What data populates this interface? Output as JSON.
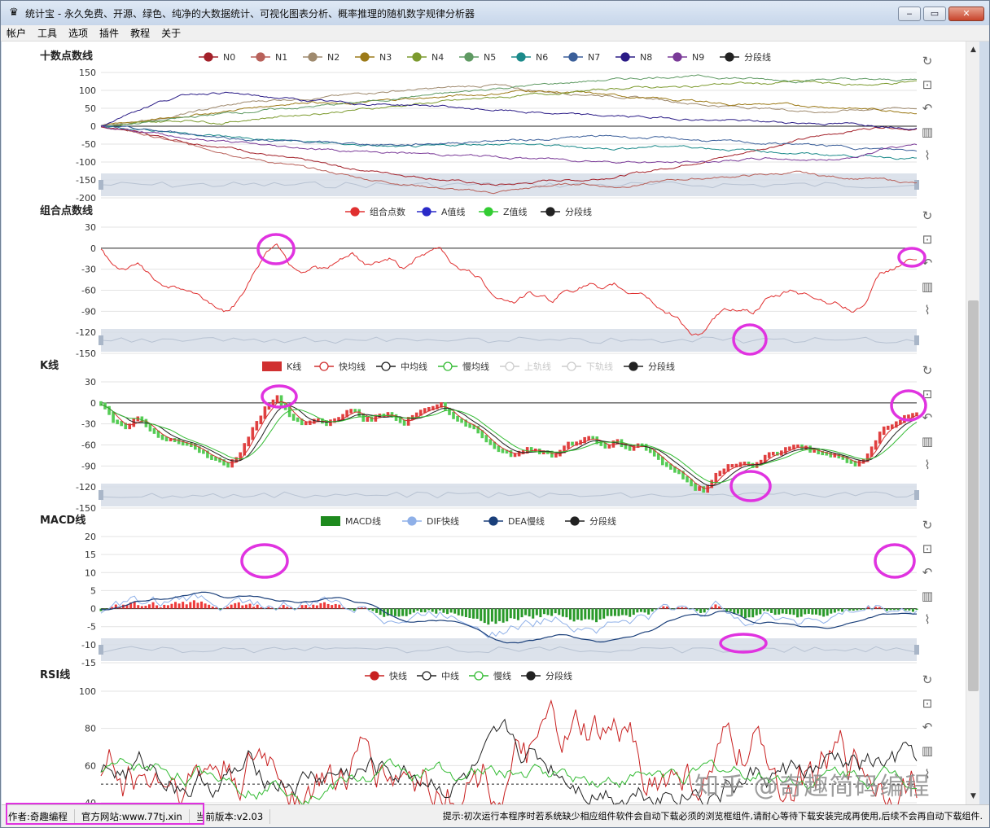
{
  "window": {
    "title": "统计宝 - 永久免费、开源、绿色、纯净的大数据统计、可视化图表分析、概率推理的随机数字规律分析器",
    "minimize": "‒",
    "restore": "▭",
    "close": "✕"
  },
  "menu": [
    "帐户",
    "工具",
    "选项",
    "插件",
    "教程",
    "关于"
  ],
  "status": {
    "author": "作者:奇趣编程",
    "site": "官方网站:www.77tj.xin",
    "version": "当前版本:v2.03",
    "tip": "提示:初次运行本程序时若系统缺少相应组件软件会自动下载必须的浏览框组件,请耐心等待下载安装完成再使用,后续不会再自动下载组件."
  },
  "watermark": "知乎 @奇趣简码编程",
  "toolbox_icons": [
    "restore-icon",
    "data-zoom-icon",
    "zoom-reset-icon",
    "bar-chart-icon",
    "line-chart-icon"
  ],
  "colors": {
    "highlight": "#e033e0",
    "zoom_bg": "#d6dde8"
  },
  "chart_data": [
    {
      "type": "line",
      "title": "十数点数线",
      "ylim": [
        -200,
        150
      ],
      "ticks": [
        150,
        100,
        50,
        0,
        -50,
        -100,
        -150,
        -200
      ],
      "series": [
        {
          "name": "N0",
          "color": "#a3212a",
          "values": [
            0,
            -12,
            -30,
            -45,
            -55,
            -70,
            -88,
            -100,
            -115,
            -125,
            -135,
            -145,
            -155,
            -165,
            -160,
            -150,
            -150,
            -140,
            -128,
            -112,
            -95,
            -80,
            -60,
            -40,
            -25,
            -10,
            0,
            -8
          ]
        },
        {
          "name": "N1",
          "color": "#b8615a",
          "values": [
            0,
            -15,
            -35,
            -55,
            -70,
            -90,
            -105,
            -120,
            -135,
            -150,
            -160,
            -170,
            -180,
            -185,
            -175,
            -165,
            -160,
            -170,
            -160,
            -150,
            -145,
            -140,
            -135,
            -130,
            -140,
            -145,
            -150,
            -160
          ]
        },
        {
          "name": "N2",
          "color": "#9f8a6e",
          "values": [
            0,
            10,
            22,
            38,
            55,
            68,
            75,
            80,
            85,
            95,
            100,
            104,
            110,
            115,
            102,
            95,
            90,
            85,
            78,
            70,
            60,
            55,
            50,
            45,
            40,
            45,
            50,
            52
          ]
        },
        {
          "name": "N3",
          "color": "#9c7a18",
          "values": [
            0,
            12,
            20,
            32,
            40,
            52,
            62,
            70,
            60,
            68,
            76,
            80,
            86,
            90,
            100,
            96,
            92,
            85,
            80,
            72,
            70,
            60,
            62,
            58,
            55,
            50,
            45,
            40
          ]
        },
        {
          "name": "N4",
          "color": "#7c9a2e",
          "values": [
            0,
            5,
            12,
            18,
            10,
            20,
            28,
            35,
            42,
            50,
            58,
            66,
            72,
            80,
            85,
            92,
            98,
            105,
            110,
            108,
            115,
            120,
            118,
            125,
            120,
            115,
            118,
            125
          ]
        },
        {
          "name": "N5",
          "color": "#5f9a63",
          "values": [
            0,
            8,
            15,
            25,
            35,
            42,
            48,
            55,
            62,
            70,
            80,
            88,
            95,
            105,
            112,
            118,
            125,
            130,
            135,
            140,
            138,
            135,
            130,
            128,
            132,
            130,
            128,
            130
          ]
        },
        {
          "name": "N6",
          "color": "#1b8a8a",
          "values": [
            0,
            -5,
            -12,
            -20,
            -28,
            -35,
            -40,
            -45,
            -50,
            -55,
            -60,
            -58,
            -52,
            -48,
            -50,
            -55,
            -60,
            -62,
            -58,
            -55,
            -60,
            -65,
            -70,
            -75,
            -80,
            -82,
            -85,
            -90
          ]
        },
        {
          "name": "N7",
          "color": "#3b5f9a",
          "values": [
            0,
            -8,
            -15,
            -22,
            -30,
            -38,
            -42,
            -45,
            -48,
            -50,
            -52,
            -48,
            -44,
            -40,
            -38,
            -35,
            -30,
            -28,
            -32,
            -35,
            -40,
            -45,
            -48,
            -50,
            -55,
            -60,
            -65,
            -68
          ]
        },
        {
          "name": "N8",
          "color": "#2a1b86",
          "values": [
            0,
            40,
            70,
            90,
            95,
            85,
            78,
            70,
            65,
            62,
            60,
            58,
            50,
            45,
            40,
            35,
            30,
            28,
            25,
            22,
            18,
            15,
            12,
            10,
            8,
            5,
            2,
            -3
          ]
        },
        {
          "name": "N9",
          "color": "#7a3a98",
          "values": [
            0,
            -10,
            -22,
            -35,
            -42,
            -50,
            -58,
            -62,
            -68,
            -72,
            -75,
            -78,
            -82,
            -85,
            -90,
            -92,
            -95,
            -98,
            -100,
            -102,
            -100,
            -95,
            -90,
            -92,
            -95,
            -85,
            -60,
            -55
          ]
        }
      ],
      "legend_extra": "分段线"
    },
    {
      "type": "line",
      "title": "组合点数线",
      "ylim": [
        -150,
        30
      ],
      "ticks": [
        30,
        0,
        -30,
        -60,
        -90,
        -120,
        -150
      ],
      "series": [
        {
          "name": "组合点数",
          "color": "#e03030",
          "values": [
            0,
            -25,
            -35,
            -20,
            -40,
            -50,
            -55,
            -60,
            -70,
            -80,
            -90,
            -75,
            -40,
            -10,
            10,
            -20,
            -30,
            -25,
            -30,
            -20,
            -10,
            -25,
            -20,
            -15,
            -30,
            -15,
            -10,
            0,
            -20,
            -30,
            -40,
            -60,
            -70,
            -75,
            -65,
            -70,
            -75,
            -60,
            -55,
            -50,
            -65,
            -55,
            -65,
            -60,
            -75,
            -90,
            -100,
            -120,
            -125,
            -100,
            -90,
            -85,
            -90,
            -75,
            -70,
            -60,
            -65,
            -70,
            -75,
            -80,
            -90,
            -75,
            -40,
            -30,
            -20,
            -15
          ]
        },
        {
          "name": "A值线",
          "color": "#2a2ac8",
          "values": []
        },
        {
          "name": "Z值线",
          "color": "#33cc33",
          "values": []
        }
      ],
      "legend_extra": "分段线"
    },
    {
      "type": "line",
      "title": "K线",
      "ylim": [
        -150,
        30
      ],
      "ticks": [
        30,
        0,
        -30,
        -60,
        -90,
        -120,
        -150
      ],
      "series": [
        {
          "name": "K线",
          "color": "#d03030",
          "values": []
        },
        {
          "name": "快均线",
          "color": "#d03030",
          "values": []
        },
        {
          "name": "中均线",
          "color": "#222222",
          "values": []
        },
        {
          "name": "慢均线",
          "color": "#33bb33",
          "values": []
        },
        {
          "name": "上轨线",
          "color": "#cccccc",
          "values": []
        },
        {
          "name": "下轨线",
          "color": "#cccccc",
          "values": []
        }
      ],
      "legend_extra": "分段线"
    },
    {
      "type": "bar",
      "title": "MACD线",
      "ylim": [
        -15,
        20
      ],
      "ticks": [
        20,
        15,
        10,
        5,
        0,
        -5,
        -10,
        -15
      ],
      "series": [
        {
          "name": "MACD线",
          "color": "#1e8a1e",
          "values": []
        },
        {
          "name": "DIF快线",
          "color": "#8fb0e8",
          "values": []
        },
        {
          "name": "DEA慢线",
          "color": "#1a3f7a",
          "values": []
        }
      ],
      "legend_extra": "分段线"
    },
    {
      "type": "line",
      "title": "RSI线",
      "ylim": [
        40,
        100
      ],
      "ticks": [
        100,
        80,
        60,
        40
      ],
      "series": [
        {
          "name": "快线",
          "color": "#c82020",
          "values": []
        },
        {
          "name": "中线",
          "color": "#222222",
          "values": []
        },
        {
          "name": "慢线",
          "color": "#33bb33",
          "values": []
        }
      ],
      "legend_extra": "分段线"
    }
  ]
}
